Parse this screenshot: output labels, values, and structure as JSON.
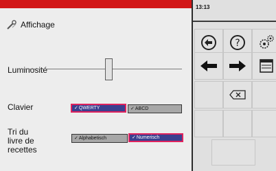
{
  "status": {
    "time": "13:13"
  },
  "screen": {
    "title": "Affichage",
    "title_icon": "wrench-screwdriver-icon"
  },
  "settings": {
    "luminosite_label": "Luminosité",
    "brightness_level": 0.55,
    "clavier_label": "Clavier",
    "clavier_options": [
      {
        "label": "QWERTY",
        "selected": true
      },
      {
        "label": "ABCD",
        "selected": false
      }
    ],
    "tri_label_line1": "Tri du",
    "tri_label_line2": "livre de",
    "tri_label_line3": "recettes",
    "tri_options": [
      {
        "label": "Alphabetisch",
        "selected": false
      },
      {
        "label": "Numerisch",
        "selected": true
      }
    ]
  },
  "keypad": {
    "back_icon": "back-circle-icon",
    "help_icon": "help-circle-icon",
    "settings_icon": "gears-icon",
    "left_icon": "arrow-left-icon",
    "right_icon": "arrow-right-icon",
    "menu_icon": "window-menu-icon",
    "delete_icon": "backspace-icon"
  },
  "colors": {
    "accent_red": "#d21718",
    "selected_fill": "#3b3f8f",
    "selected_border": "#e0225d"
  }
}
